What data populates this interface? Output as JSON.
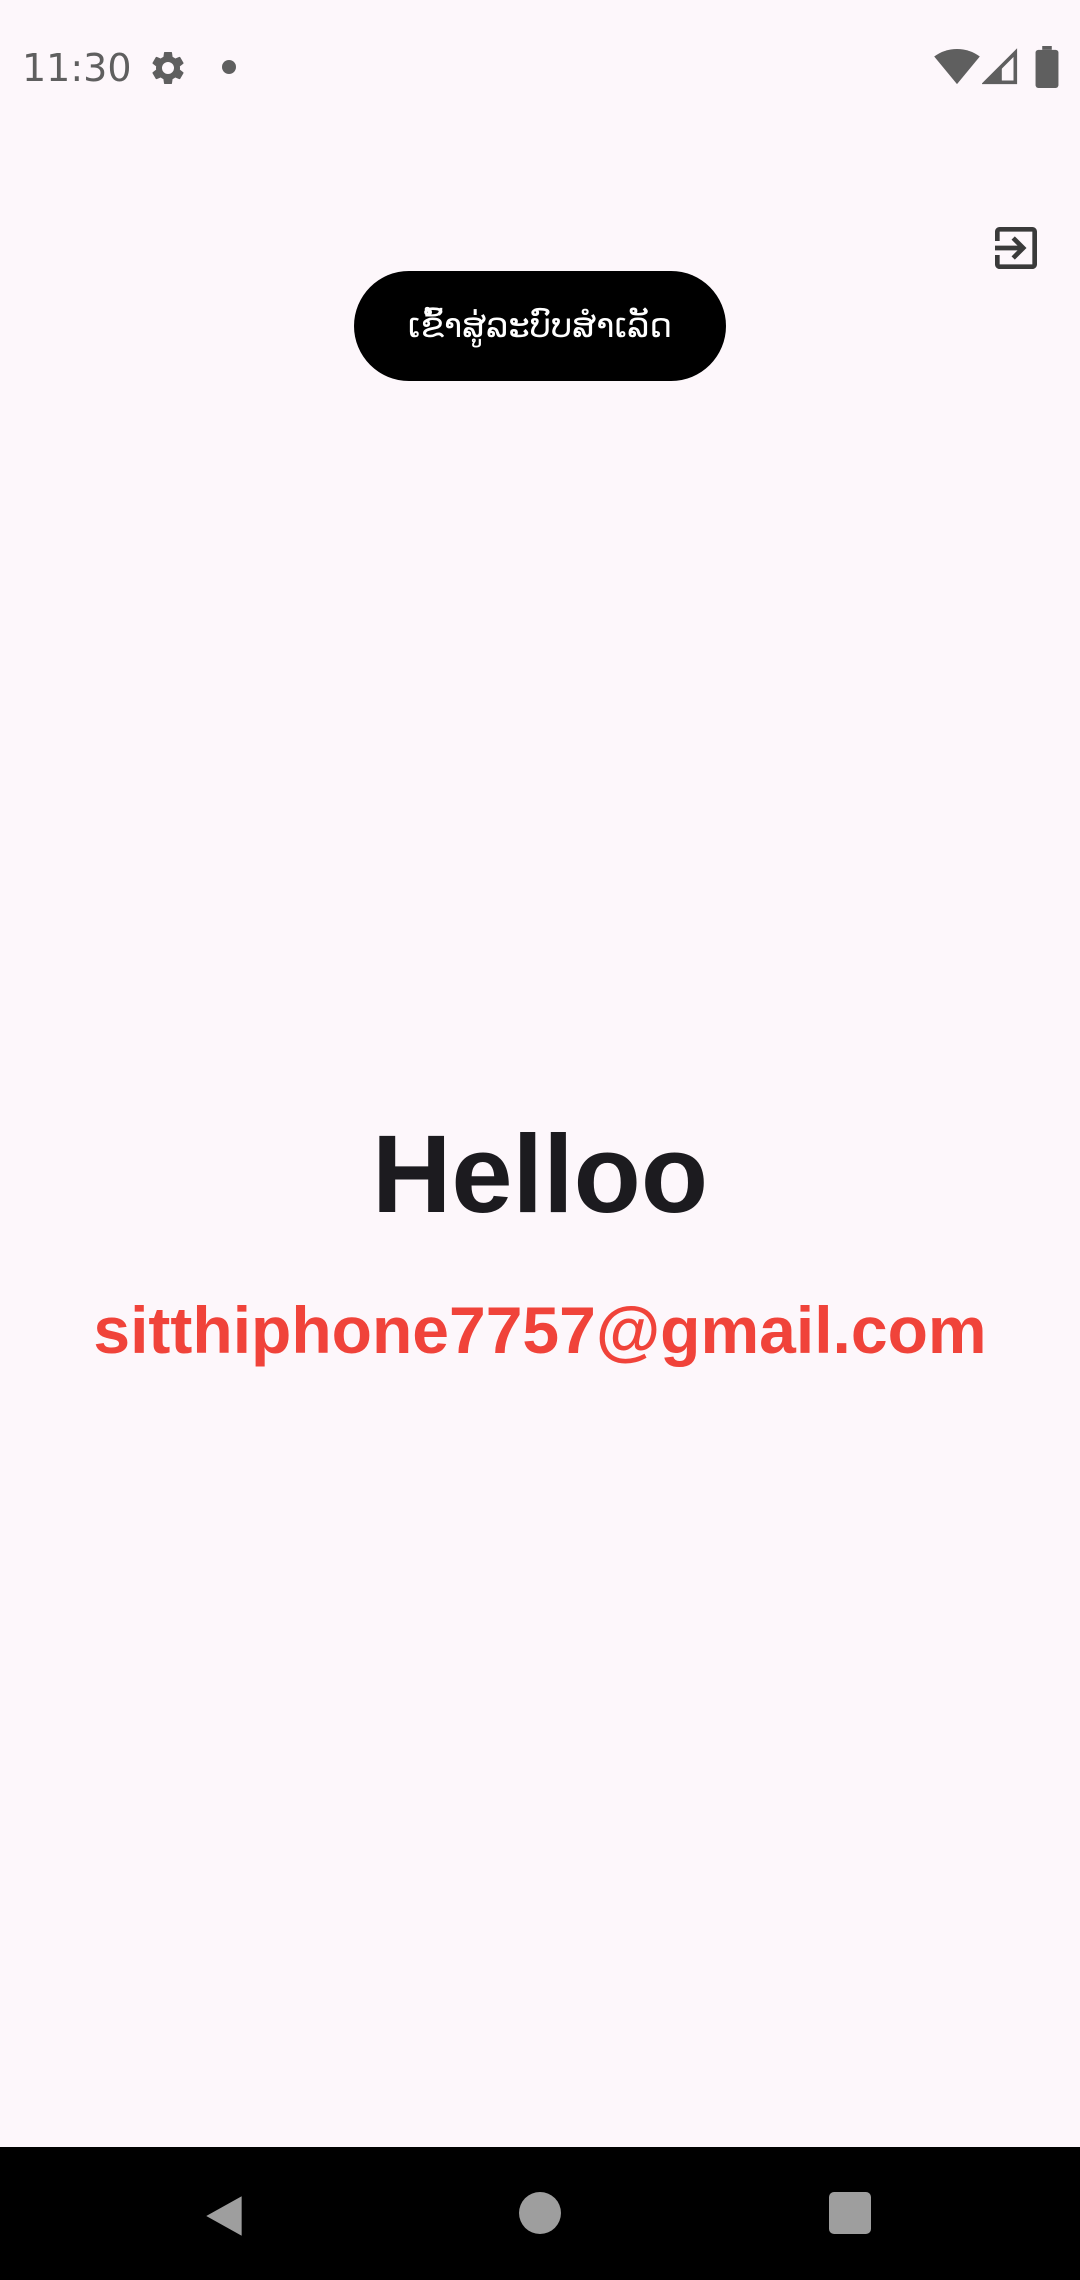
{
  "status_bar": {
    "time": "11:30",
    "icons": [
      "gear-icon",
      "notification-dot-icon",
      "wifi-icon",
      "signal-icon",
      "battery-icon"
    ]
  },
  "header": {
    "logout_icon": "logout-icon"
  },
  "toast": {
    "message": "ເຂົ້າສູ່ລະບົບສຳເລັດ"
  },
  "main": {
    "greeting": "Helloo",
    "email": "sitthiphone7757@gmail.com"
  },
  "nav_bar": {
    "icons": [
      "back-icon",
      "home-icon",
      "recents-icon"
    ]
  },
  "colors": {
    "background": "#fdf7fb",
    "greeting_text": "#1c1b1f",
    "email_text": "#f0433a",
    "toast_bg": "#000000",
    "toast_text": "#ffffff",
    "nav_bar_bg": "#000000"
  }
}
